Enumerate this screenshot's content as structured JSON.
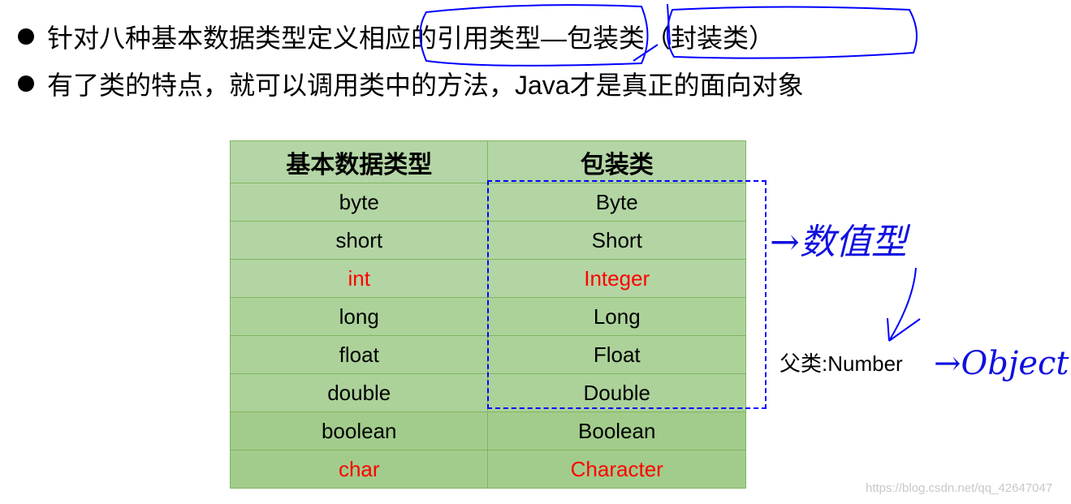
{
  "bullets": [
    {
      "text": "针对八种基本数据类型定义相应的引用类型—包装类（封装类）"
    },
    {
      "text": "有了类的特点，就可以调用类中的方法，Java才是真正的面向对象"
    }
  ],
  "table": {
    "headers": [
      "基本数据类型",
      "包装类"
    ],
    "rows": [
      {
        "primitive": "byte",
        "wrapper": "Byte",
        "highlight": false
      },
      {
        "primitive": "short",
        "wrapper": "Short",
        "highlight": false
      },
      {
        "primitive": "int",
        "wrapper": "Integer",
        "highlight": true
      },
      {
        "primitive": "long",
        "wrapper": "Long",
        "highlight": false
      },
      {
        "primitive": "float",
        "wrapper": "Float",
        "highlight": false
      },
      {
        "primitive": "double",
        "wrapper": "Double",
        "highlight": false
      },
      {
        "primitive": "boolean",
        "wrapper": "Boolean",
        "highlight": false
      },
      {
        "primitive": "char",
        "wrapper": "Character",
        "highlight": true
      }
    ]
  },
  "parent_label": "父类:Number",
  "annotations": {
    "numeric": "→数值型",
    "object": "→Object"
  },
  "watermark": "https://blog.csdn.net/qq_42647047",
  "colors": {
    "highlight": "#ff0000",
    "ink": "#0000ff",
    "cell": "#b4d5a5",
    "border": "#7fb55e"
  }
}
